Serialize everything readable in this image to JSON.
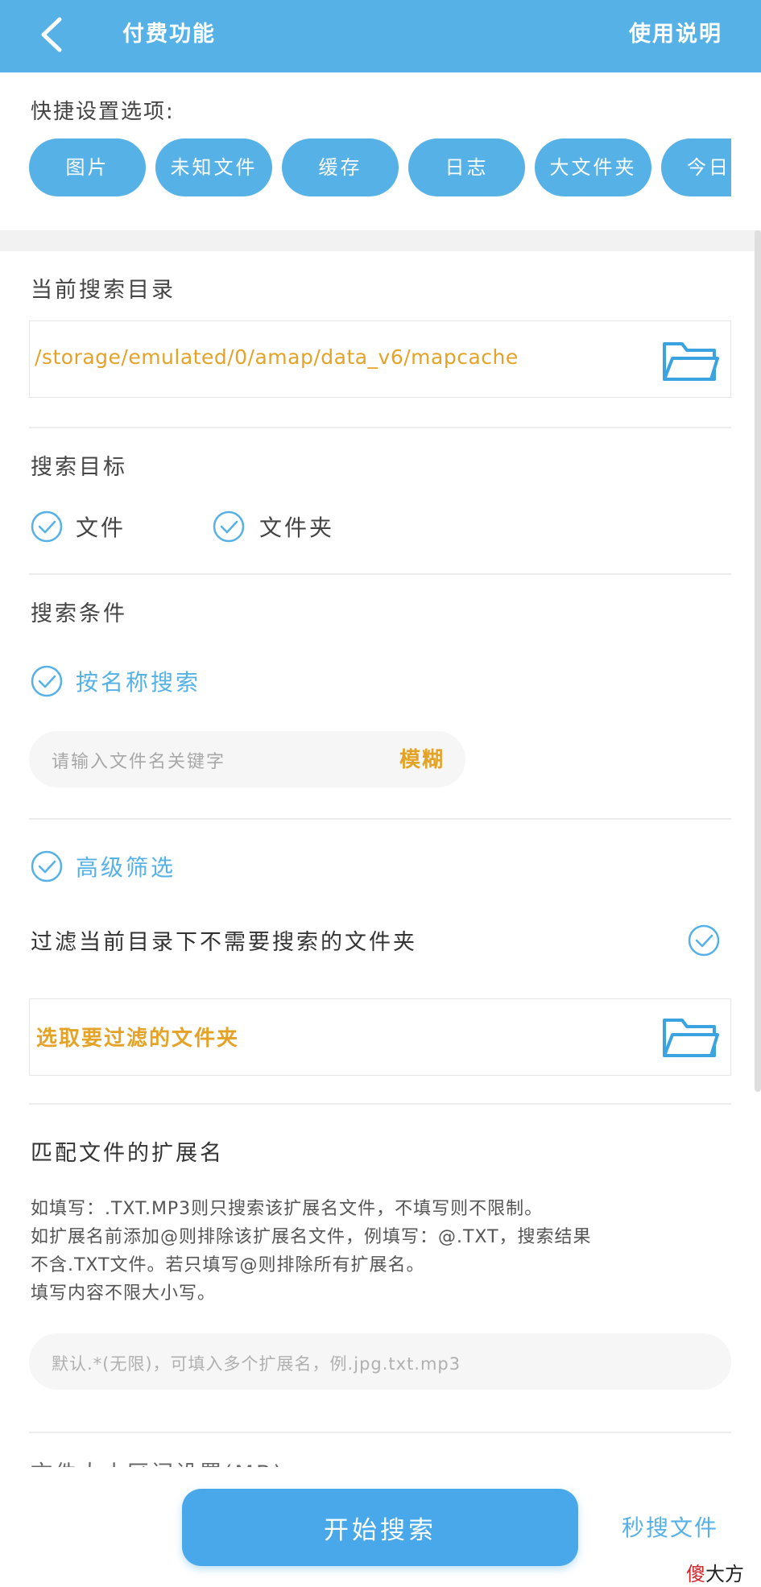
{
  "header": {
    "title": "付费功能",
    "help": "使用说明",
    "background_color": "#55b1e6"
  },
  "quick_settings": {
    "label": "快捷设置选项:",
    "chips": [
      "图片",
      "未知文件",
      "缓存",
      "日志",
      "大文件夹",
      "今日文"
    ]
  },
  "search_dir": {
    "label": "当前搜索目录",
    "path": "/storage/emulated/0/amap/data_v6/mapcache"
  },
  "search_target": {
    "label": "搜索目标",
    "options": [
      {
        "label": "文件",
        "checked": true
      },
      {
        "label": "文件夹",
        "checked": true
      }
    ]
  },
  "search_conditions": {
    "label": "搜索条件",
    "by_name_label": "按名称搜索",
    "by_name_checked": true,
    "keyword_placeholder": "请输入文件名关键字",
    "fuzzy_label": "模糊"
  },
  "advanced": {
    "label": "高级筛选",
    "checked": true,
    "filter_folders_label": "过滤当前目录下不需要搜索的文件夹",
    "filter_folders_checked": true,
    "pick_folders_label": "选取要过滤的文件夹"
  },
  "extensions": {
    "title": "匹配文件的扩展名",
    "desc_lines": [
      "如填写：.TXT.MP3则只搜索该扩展名文件，不填写则不限制。",
      "如扩展名前添加@则排除该扩展名文件，例填写：@.TXT，搜索结果",
      "不含.TXT文件。若只填写@则排除所有扩展名。",
      "填写内容不限大小写。"
    ],
    "placeholder": "默认.*(无限)，可填入多个扩展名，例.jpg.txt.mp3"
  },
  "partial_section_label": "文件大小区间设置(MB)",
  "footer": {
    "start_button": "开始搜索",
    "quick_search_link": "秒搜文件"
  },
  "watermark": {
    "red_part": "傻",
    "black_part": "大方"
  },
  "colors": {
    "accent": "#55b1e6",
    "highlight": "#e4a326"
  },
  "icons": {
    "back": "chevron-left-icon",
    "folder": "folder-open-icon",
    "check": "check-circle-icon"
  }
}
